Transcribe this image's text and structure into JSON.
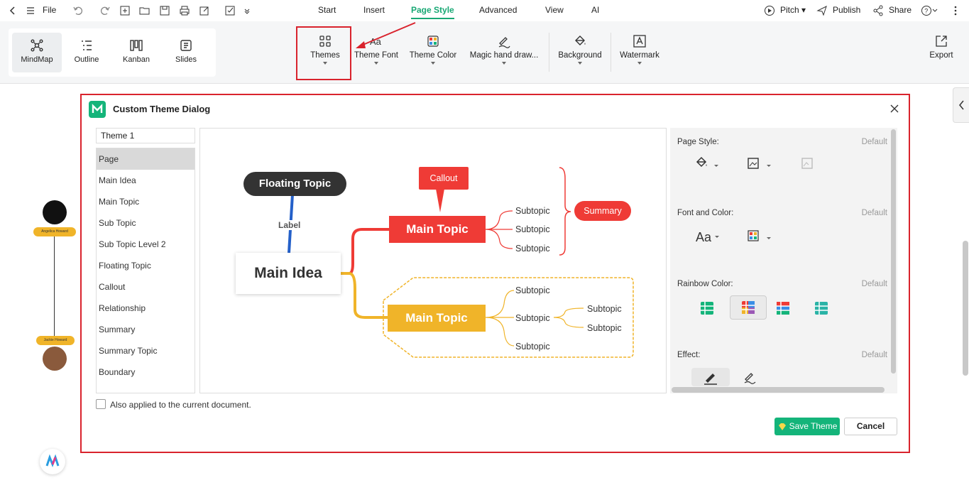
{
  "menubar": {
    "file": "File",
    "tabs": [
      "Start",
      "Insert",
      "Page Style",
      "Advanced",
      "View",
      "AI"
    ],
    "active_tab": "Page Style",
    "pitch": "Pitch",
    "publish": "Publish",
    "share": "Share"
  },
  "ribbon": {
    "views": [
      "MindMap",
      "Outline",
      "Kanban",
      "Slides"
    ],
    "tools": [
      "Themes",
      "Theme Font",
      "Theme Color",
      "Magic hand draw...",
      "Background",
      "Watermark"
    ],
    "export": "Export"
  },
  "canvas": {
    "person1": "Angelica Howard",
    "person2": "Jackie Howard"
  },
  "dialog": {
    "title": "Custom Theme Dialog",
    "theme_name": "Theme 1",
    "items": [
      "Page",
      "Main Idea",
      "Main Topic",
      "Sub Topic",
      "Sub Topic Level 2",
      "Floating Topic",
      "Callout",
      "Relationship",
      "Summary",
      "Summary Topic",
      "Boundary"
    ],
    "selected_item": "Page",
    "checkbox_label": "Also applied to the current document.",
    "save_label": "Save Theme",
    "cancel_label": "Cancel"
  },
  "preview": {
    "floating": "Floating Topic",
    "label": "Label",
    "main_idea": "Main Idea",
    "callout": "Callout",
    "main_topic_1": "Main Topic",
    "main_topic_2": "Main Topic",
    "summary": "Summary",
    "sub1": "Subtopic",
    "sub2": "Subtopic",
    "sub3": "Subtopic",
    "sub4": "Subtopic",
    "sub5": "Subtopic",
    "sub6": "Subtopic",
    "sub7": "Subtopic",
    "sub8": "Subtopic"
  },
  "panel": {
    "page_style": "Page Style:",
    "font_color": "Font and Color:",
    "rainbow": "Rainbow Color:",
    "effect": "Effect:",
    "default": "Default",
    "font_icon_text": "Aa"
  },
  "colors": {
    "accent": "#18a874",
    "red": "#ef3b36",
    "yellow": "#f0b429",
    "dark": "#333333",
    "highlight": "#d9232d"
  }
}
